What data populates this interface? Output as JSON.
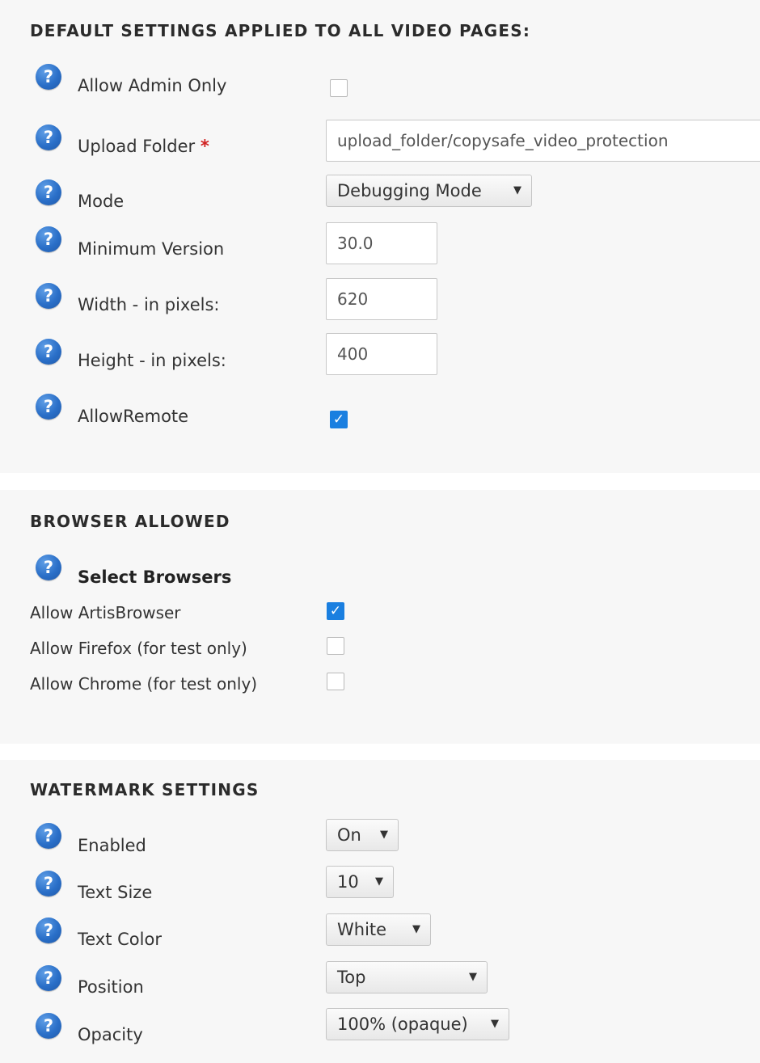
{
  "defaults": {
    "title": "DEFAULT SETTINGS APPLIED TO ALL VIDEO PAGES:",
    "help_icon": "question-mark-help-icon",
    "allow_admin_only": {
      "label": "Allow Admin Only",
      "checked": false
    },
    "upload_folder": {
      "label": "Upload Folder",
      "required_marker": "*",
      "value": "upload_folder/copysafe_video_protection"
    },
    "mode": {
      "label": "Mode",
      "selected": "Debugging Mode"
    },
    "minimum_version": {
      "label": "Minimum Version",
      "value": "30.0"
    },
    "width": {
      "label": "Width - in pixels:",
      "value": "620"
    },
    "height": {
      "label": "Height - in pixels:",
      "value": "400"
    },
    "allow_remote": {
      "label": "AllowRemote",
      "checked": true
    }
  },
  "browsers": {
    "title": "BROWSER ALLOWED",
    "select_label": "Select Browsers",
    "items": [
      {
        "label": "Allow ArtisBrowser",
        "checked": true
      },
      {
        "label": "Allow Firefox (for test only)",
        "checked": false
      },
      {
        "label": "Allow Chrome (for test only)",
        "checked": false
      }
    ]
  },
  "watermark": {
    "title": "WATERMARK SETTINGS",
    "enabled": {
      "label": "Enabled",
      "selected": "On"
    },
    "text_size": {
      "label": "Text Size",
      "selected": "10"
    },
    "text_color": {
      "label": "Text Color",
      "selected": "White"
    },
    "position": {
      "label": "Position",
      "selected": "Top"
    },
    "opacity": {
      "label": "Opacity",
      "selected": "100% (opaque)"
    }
  },
  "icons": {
    "help": "?",
    "check": "✓",
    "dropdown_arrow": "▼"
  },
  "colors": {
    "panel_background": "#f7f7f7",
    "help_icon": "#2a6fc8",
    "checkbox_checked": "#1a7fe0",
    "required_marker": "#d02020"
  }
}
